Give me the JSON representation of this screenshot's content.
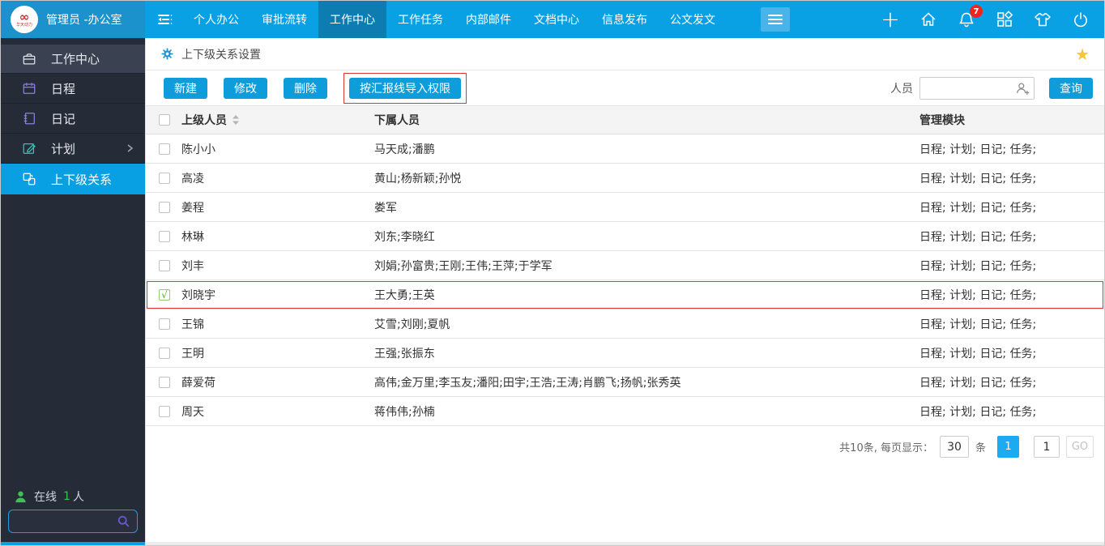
{
  "topbar": {
    "logo_glyph": "∞",
    "logo_subtext": "华天动力",
    "user_label": "管理员 -办公室",
    "nav": [
      {
        "label": "个人办公"
      },
      {
        "label": "审批流转"
      },
      {
        "label": "工作中心"
      },
      {
        "label": "工作任务"
      },
      {
        "label": "内部邮件"
      },
      {
        "label": "文档中心"
      },
      {
        "label": "信息发布"
      },
      {
        "label": "公文发文"
      }
    ],
    "plus_glyph": "+",
    "notification_count": "7"
  },
  "sidebar": {
    "items": [
      {
        "label": "工作中心"
      },
      {
        "label": "日程"
      },
      {
        "label": "日记"
      },
      {
        "label": "计划"
      },
      {
        "label": "上下级关系"
      }
    ],
    "online_label": "在线",
    "online_count": "1",
    "online_suffix": "人"
  },
  "page": {
    "title": "上下级关系设置",
    "favorite_glyph": "★"
  },
  "toolbar": {
    "new_label": "新建",
    "edit_label": "修改",
    "delete_label": "删除",
    "import_label": "按汇报线导入权限",
    "person_label": "人员",
    "query_label": "查询"
  },
  "table": {
    "check_glyph": "√",
    "headers": {
      "superior": "上级人员",
      "subordinates": "下属人员",
      "modules": "管理模块"
    },
    "rows": [
      {
        "superior": "陈小小",
        "subordinates": "马天成;潘鹏",
        "modules": "日程; 计划; 日记; 任务;",
        "checked": false,
        "highlighted": false
      },
      {
        "superior": "高凌",
        "subordinates": "黄山;杨新颖;孙悦",
        "modules": "日程; 计划; 日记; 任务;",
        "checked": false,
        "highlighted": false
      },
      {
        "superior": "姜程",
        "subordinates": "娄军",
        "modules": "日程; 计划; 日记; 任务;",
        "checked": false,
        "highlighted": false
      },
      {
        "superior": "林琳",
        "subordinates": "刘东;李晓红",
        "modules": "日程; 计划; 日记; 任务;",
        "checked": false,
        "highlighted": false
      },
      {
        "superior": "刘丰",
        "subordinates": "刘娟;孙富贵;王刚;王伟;王萍;于学军",
        "modules": "日程; 计划; 日记; 任务;",
        "checked": false,
        "highlighted": false
      },
      {
        "superior": "刘晓宇",
        "subordinates": "王大勇;王英",
        "modules": "日程; 计划; 日记; 任务;",
        "checked": true,
        "highlighted": true
      },
      {
        "superior": "王锦",
        "subordinates": "艾雪;刘刚;夏帆",
        "modules": "日程; 计划; 日记; 任务;",
        "checked": false,
        "highlighted": false
      },
      {
        "superior": "王明",
        "subordinates": "王强;张振东",
        "modules": "日程; 计划; 日记; 任务;",
        "checked": false,
        "highlighted": false
      },
      {
        "superior": "薛爱荷",
        "subordinates": "高伟;金万里;李玉友;潘阳;田宇;王浩;王涛;肖鹏飞;扬帆;张秀英",
        "modules": "日程; 计划; 日记; 任务;",
        "checked": false,
        "highlighted": false
      },
      {
        "superior": "周天",
        "subordinates": "蒋伟伟;孙楠",
        "modules": "日程; 计划; 日记; 任务;",
        "checked": false,
        "highlighted": false
      }
    ]
  },
  "pagination": {
    "total_label": "共10条, 每页显示：",
    "page_size": "30",
    "unit_label": "条",
    "current_page": "1",
    "goto_value": "1",
    "go_label": "GO"
  }
}
